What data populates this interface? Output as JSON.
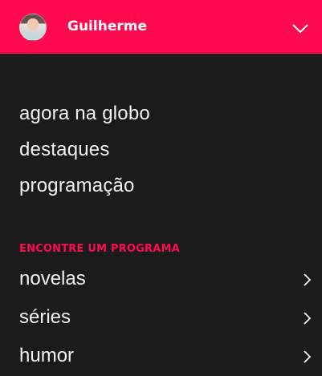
{
  "header": {
    "username": "Guilherme",
    "avatar_icon": "user-avatar",
    "menu_icon": "chevron-down-icon",
    "background_color": "#ff0a4e"
  },
  "main_nav": {
    "items": [
      {
        "label": "agora na globo"
      },
      {
        "label": "destaques"
      },
      {
        "label": "programação"
      }
    ]
  },
  "programs": {
    "section_title": "ENCONTRE UM PROGRAMA",
    "accent_color": "#ff0a4e",
    "items": [
      {
        "label": "novelas",
        "icon": "chevron-right-icon"
      },
      {
        "label": "séries",
        "icon": "chevron-right-icon"
      },
      {
        "label": "humor",
        "icon": "chevron-right-icon"
      }
    ]
  }
}
